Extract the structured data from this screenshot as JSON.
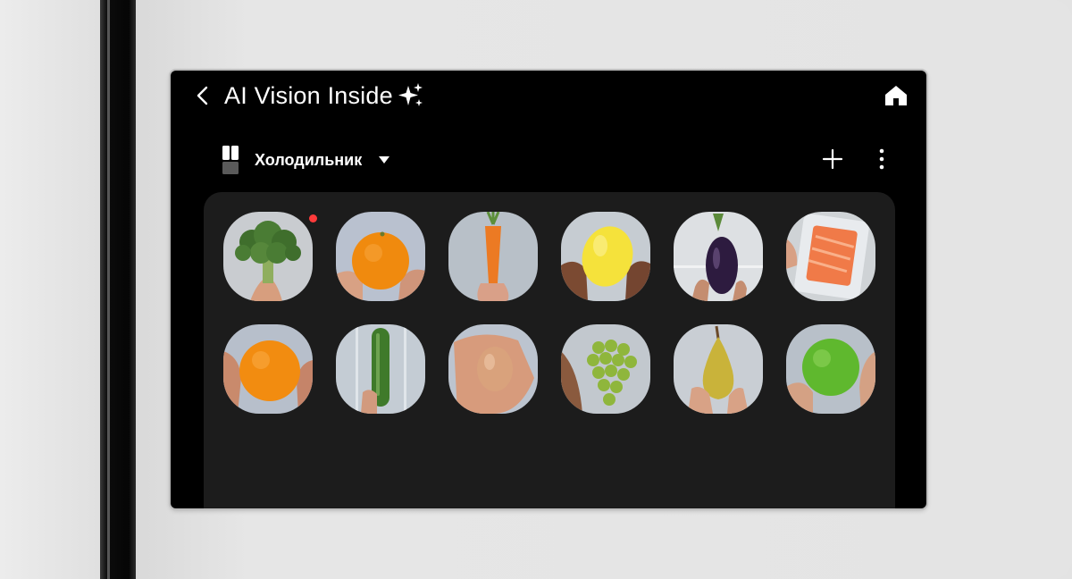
{
  "app": {
    "title": "AI Vision Inside",
    "title_icon": "sparkles-icon",
    "back_icon": "chevron-left-icon",
    "home_icon": "home-icon"
  },
  "device": {
    "icon": "fridge-icon",
    "name": "Холодильник",
    "dropdown_icon": "caret-down-icon"
  },
  "actions": {
    "add_icon": "plus-icon",
    "more_icon": "more-vertical-icon"
  },
  "colors": {
    "screen_bg": "#000000",
    "panel_bg": "#1c1c1c",
    "new_badge": "#ff3b3b"
  },
  "food_items": [
    {
      "name": "broccoli",
      "new": true
    },
    {
      "name": "orange",
      "new": false
    },
    {
      "name": "carrot",
      "new": false
    },
    {
      "name": "lemon",
      "new": false
    },
    {
      "name": "eggplant",
      "new": false
    },
    {
      "name": "salmon-fillet",
      "new": false
    },
    {
      "name": "orange",
      "new": false
    },
    {
      "name": "cucumber",
      "new": false
    },
    {
      "name": "egg",
      "new": false
    },
    {
      "name": "green-grapes",
      "new": false
    },
    {
      "name": "pear",
      "new": false
    },
    {
      "name": "green-apple",
      "new": false
    }
  ]
}
